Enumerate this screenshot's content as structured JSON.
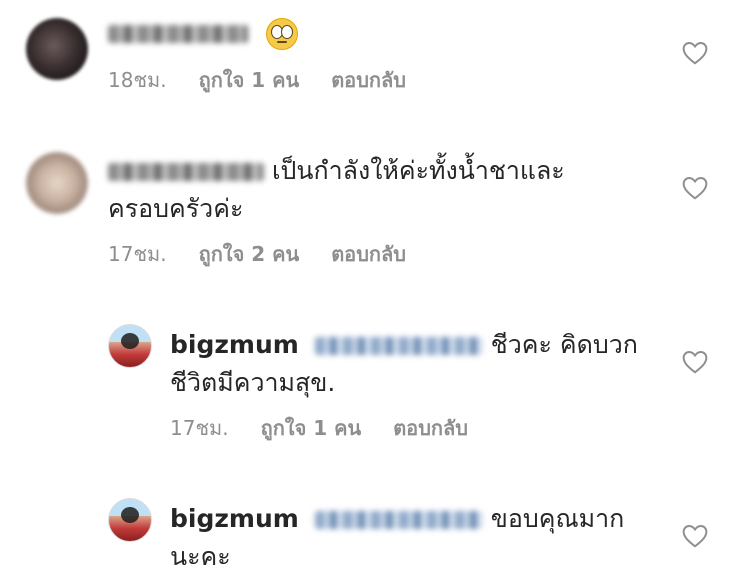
{
  "comments": [
    {
      "text": "",
      "has_emoji": true,
      "emoji": "eye-roll-emoji",
      "time": "18ชม.",
      "likes": "ถูกใจ 1 คน",
      "reply": "ตอบกลับ"
    },
    {
      "text_line1": "เป็นกำลังให้ค่ะทั้งน้ำชาและ",
      "text_line2": "ครอบครัวค่ะ",
      "time": "17ชม.",
      "likes": "ถูกใจ 2 คน",
      "reply": "ตอบกลับ"
    }
  ],
  "replies": [
    {
      "username": "bigzmum",
      "text_line1": "ชีวคะ คิดบวก",
      "text_line2": "ชีวิตมีความสุข.",
      "time": "17ชม.",
      "likes": "ถูกใจ 1 คน",
      "reply": "ตอบกลับ"
    },
    {
      "username": "bigzmum",
      "text_line1": "ขอบคุณมาก",
      "text_line2": "นะคะ"
    }
  ],
  "colors": {
    "text": "#262626",
    "meta": "#8e8e8e",
    "heart": "#8e8e8e"
  },
  "icons": {
    "like": "heart-outline-icon"
  }
}
